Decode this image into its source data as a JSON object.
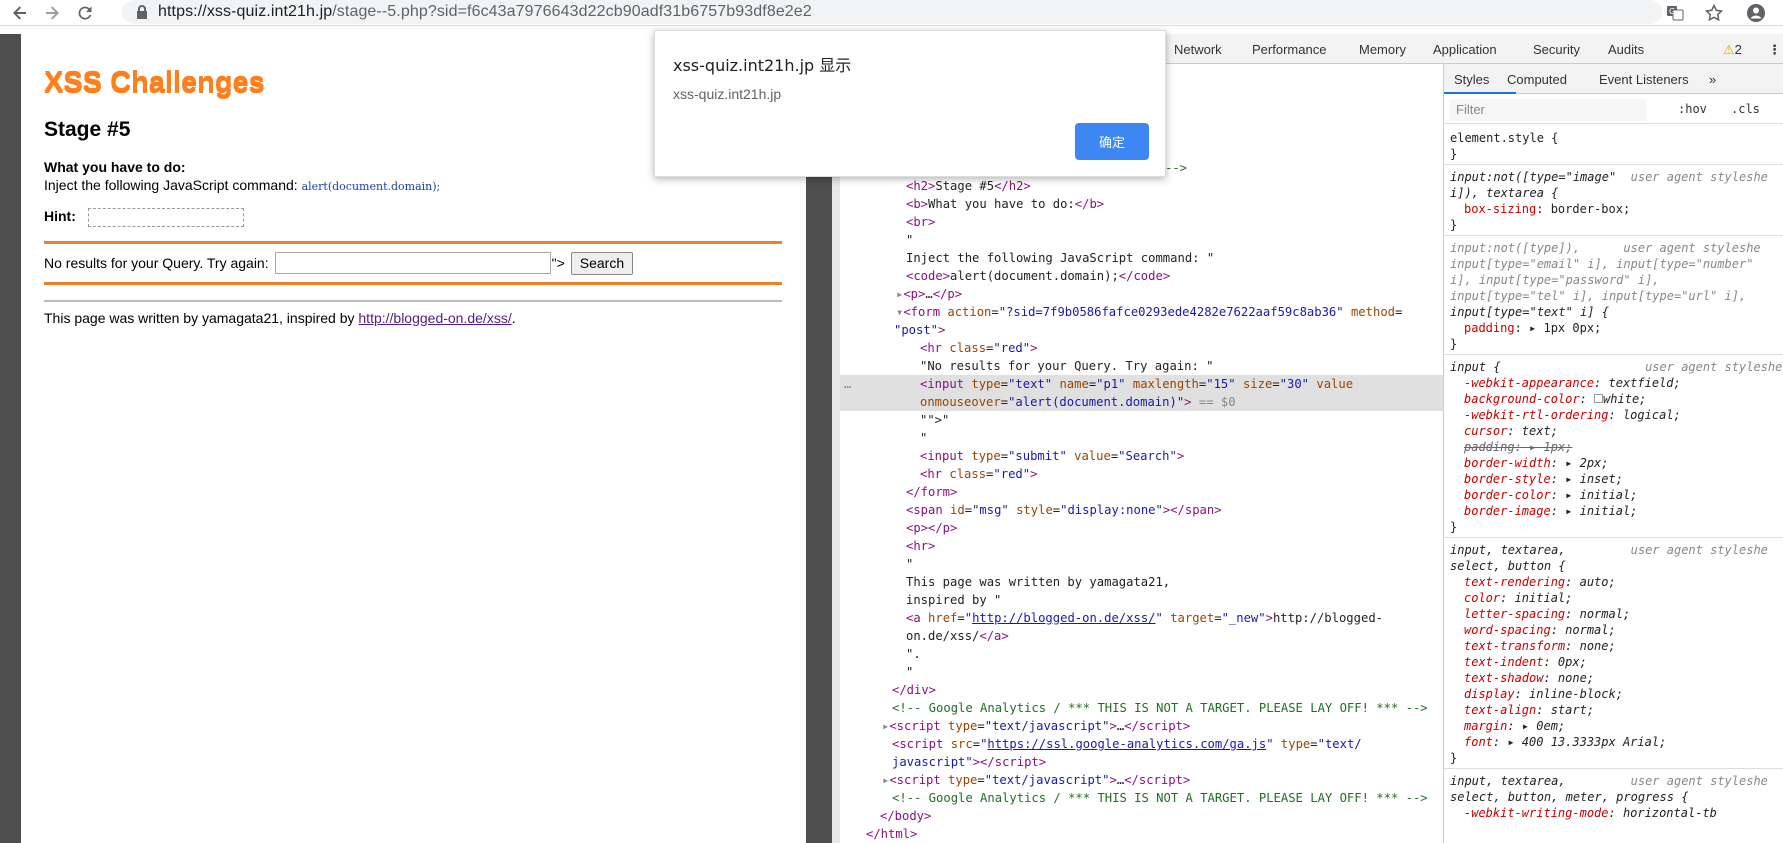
{
  "browser": {
    "url_host": "https://xss-quiz.int21h.jp",
    "url_path": "/stage--5.php?sid=f6c43a7976643d22cb90adf31b6757b93df8e2e2"
  },
  "page": {
    "site_title": "XSS Challenges",
    "stage_title": "Stage #5",
    "task_label": "What you have to do:",
    "task_prefix": "Inject the following JavaScript command: ",
    "task_code": "alert(document.domain);",
    "hint_label": "Hint:",
    "query_text": "No results for your Query. Try again:",
    "query_suffix": "\">",
    "search_label": "Search",
    "footer_prefix": "This page was written by yamagata21, inspired by ",
    "footer_link": "http://blogged-on.de/xss/",
    "footer_suffix": "."
  },
  "alert": {
    "title": "xss-quiz.int21h.jp 显示",
    "message": "xss-quiz.int21h.jp",
    "ok_label": "确定"
  },
  "devtools": {
    "tabs": [
      "Network",
      "Performance",
      "Memory",
      "Application",
      "Security",
      "Audits"
    ],
    "warning_count": "2",
    "side_tabs": [
      "Styles",
      "Computed",
      "Event Listeners"
    ],
    "filter_placeholder": "Filter",
    "hov": ":hov",
    "cls": ".cls"
  }
}
